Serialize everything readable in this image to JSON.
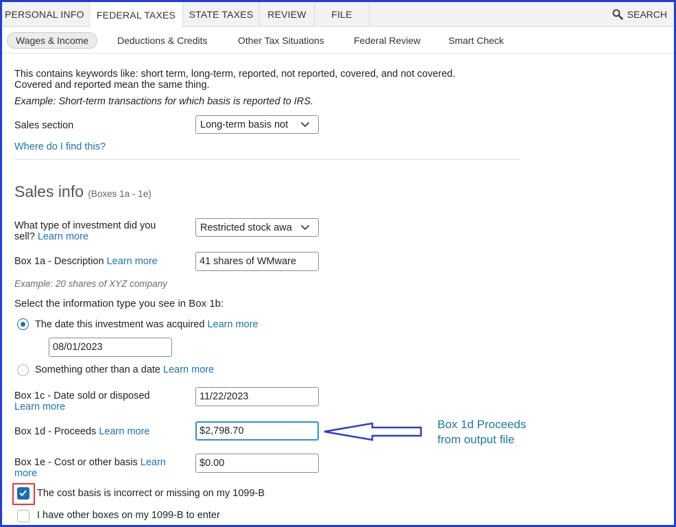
{
  "top_tabs": [
    {
      "label": "PERSONAL INFO"
    },
    {
      "label": "FEDERAL TAXES"
    },
    {
      "label": "STATE TAXES"
    },
    {
      "label": "REVIEW"
    },
    {
      "label": "FILE"
    }
  ],
  "search": {
    "label": "SEARCH"
  },
  "sub_tabs": [
    {
      "label": "Wages & Income"
    },
    {
      "label": "Deductions & Credits"
    },
    {
      "label": "Other Tax Situations"
    },
    {
      "label": "Federal Review"
    },
    {
      "label": "Smart Check"
    }
  ],
  "intro": {
    "line1": "This contains keywords like: short term, long-term, reported, not reported, covered, and not covered.",
    "line2": "Covered and reported mean the same thing.",
    "example": "Example: Short-term transactions for which basis is reported to IRS."
  },
  "sales_section": {
    "label": "Sales section",
    "value": "Long-term basis not",
    "help_link": "Where do I find this?"
  },
  "sales_info": {
    "heading": "Sales info",
    "subheading": "(Boxes 1a - 1e)"
  },
  "investment_type": {
    "label_line1": "What type of investment did you",
    "label_line2": "sell?",
    "learn_more": "Learn more",
    "value": "Restricted stock awa"
  },
  "box1a": {
    "label": "Box 1a - Description",
    "learn_more": "Learn more",
    "value": "41 shares of WMware",
    "example": "Example: 20 shares of XYZ company"
  },
  "box1b": {
    "prompt": "Select the information type you see in Box 1b:",
    "option_date": "The date this investment was acquired",
    "option_date_learn_more": "Learn more",
    "date_value": "08/01/2023",
    "option_other": "Something other than a date",
    "option_other_learn_more": "Learn more",
    "selected": "date"
  },
  "box1c": {
    "label": "Box 1c - Date sold or disposed",
    "learn_more": "Learn more",
    "value": "11/22/2023"
  },
  "box1d": {
    "label": "Box 1d - Proceeds",
    "learn_more": "Learn more",
    "value": "$2,798.70"
  },
  "box1e": {
    "label": "Box 1e - Cost or other basis",
    "learn_more_1": "Learn",
    "learn_more_2": "more",
    "value": "$0.00"
  },
  "checkboxes": {
    "cost_basis_incorrect": {
      "label": "The cost basis is incorrect or missing on my 1099-B",
      "checked": true
    },
    "other_boxes": {
      "label": "I have other boxes on my 1099-B to enter",
      "checked": false
    }
  },
  "annotation": {
    "line1": "Box 1d Proceeds",
    "line2": "from output file"
  },
  "colors": {
    "frame": "#1f3fd6",
    "link": "#1a73b5",
    "annotation": "#1a7aa3",
    "arrow": "#2f3fc7",
    "highlight_box": "#e53b2a"
  },
  "icons": [
    "search-icon",
    "chevron-down-icon",
    "check-icon",
    "arrow-left-icon"
  ]
}
